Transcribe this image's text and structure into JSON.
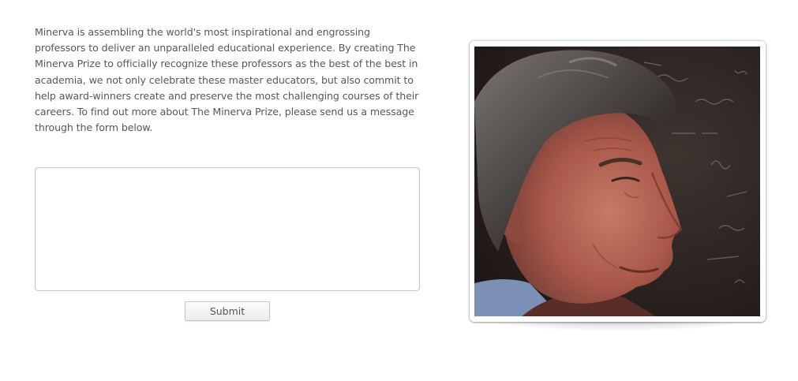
{
  "intro": {
    "text": "Minerva is assembling the world's most inspirational and engrossing professors to deliver an unparalleled educational experience. By creating The Minerva Prize to officially recognize these professors as the best of the best in academia, we not only celebrate these master educators, but also commit to help award-winners create and preserve the most challenging courses of their careers. To find out more about The Minerva Prize, please send us a message through the form below."
  },
  "form": {
    "message_value": "",
    "message_placeholder": "",
    "submit_label": "Submit"
  },
  "photo": {
    "subject": "portrait-photo",
    "background_color": "#2a221f"
  }
}
